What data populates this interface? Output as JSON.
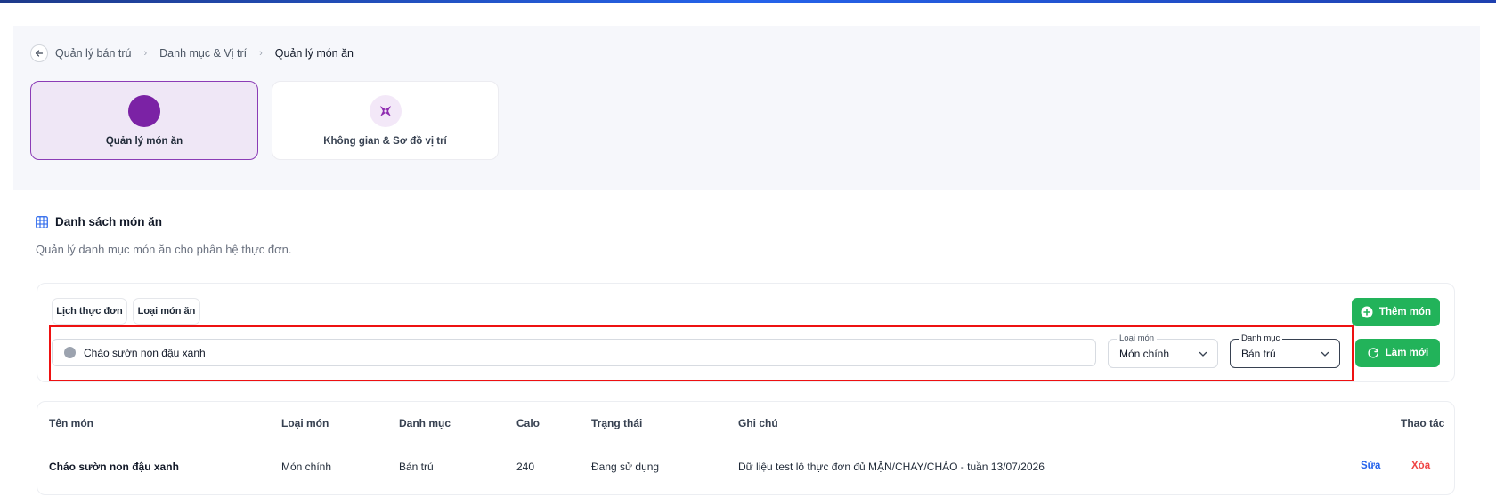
{
  "breadcrumb": {
    "items": [
      "Quản lý bán trú",
      "Danh mục & Vị trí"
    ],
    "current": "Quản lý món ăn",
    "separator": "›"
  },
  "module_tabs": [
    {
      "label": "Quản lý món ăn",
      "active": true
    },
    {
      "label": "Không gian & Sơ đồ vị trí",
      "active": false
    }
  ],
  "section": {
    "title": "Danh sách món ăn",
    "description": "Quản lý danh mục món ăn cho phân hệ thực đơn."
  },
  "toolbar": {
    "chips": [
      "Lịch thực đơn",
      "Loại món ăn"
    ],
    "add_label": "Thêm món",
    "refresh_label": "Làm mới"
  },
  "filters": {
    "search_value": "Cháo sườn non đậu xanh",
    "dish_type": {
      "label": "Loại món",
      "value": "Món chính"
    },
    "category": {
      "label": "Danh mục",
      "value": "Bán trú"
    }
  },
  "table": {
    "headers": [
      "Tên món",
      "Loại món",
      "Danh mục",
      "Calo",
      "Trạng thái",
      "Ghi chú",
      "Thao tác"
    ],
    "rows": [
      {
        "name": "Cháo sườn non đậu xanh",
        "type": "Món chính",
        "category": "Bán trú",
        "calo": "240",
        "status": "Đang sử dụng",
        "note": "Dữ liệu test lô thực đơn đủ MẶN/CHAY/CHÁO - tuần 13/07/2026",
        "edit": "Sửa",
        "delete": "Xóa"
      }
    ]
  },
  "colors": {
    "accent": "#7b22a5",
    "active_tab_bg": "#efe7f6",
    "primary_green": "#22b35a",
    "edit_blue": "#2563eb",
    "delete_red": "#ef4444",
    "highlight_red": "#ee1111"
  },
  "icons": [
    "back-arrow-icon",
    "dish-icon",
    "map-pin-icon",
    "grid-icon",
    "search-icon",
    "chevron-down-icon",
    "plus-circle-icon",
    "refresh-icon"
  ]
}
